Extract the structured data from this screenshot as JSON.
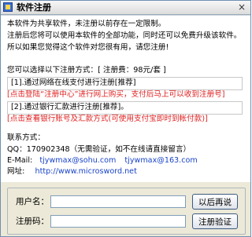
{
  "window": {
    "title": "软件注册",
    "close_glyph": "×"
  },
  "intro": {
    "line1": "本软件为共享软件，未注册以前存在一定限制。",
    "line2": "注册后您将可以使用本软件的全部功能，同时还可以免费升级该软件。",
    "line3": "所以如果您觉得这个软件对您很有用，请您注册!"
  },
  "pricing": {
    "text": "您可以选择以下注册方式：[ 注册费：98元/套 ]"
  },
  "method1": {
    "label": "[1].通过网络在线支付进行注册[推荐]",
    "note": "[点击登陆“注册中心”进行网上购买，支付后马上可以收到注册号]"
  },
  "method2": {
    "label": "[2].通过银行汇款进行注册[推荐]。",
    "note": "[点击查看银行账号及汇款方式(可使用支付宝即时到帐付款)]"
  },
  "contact": {
    "heading": "联系方式：",
    "qq": "QQ：170902348（无需验证，如不在线请直接留言）",
    "email_label": "E-Mail:",
    "email1": "tjywmax@sohu.com",
    "email2": "tjywmax@163.com",
    "site_label": "网址:",
    "site": "http://www.microsword.net"
  },
  "form": {
    "username_label": "用户名：",
    "username_value": "",
    "code_label": "注册码：",
    "code_value": "",
    "later_button": "以后再说",
    "verify_button": "注册验证"
  },
  "colors": {
    "accent_red": "#e01f1f",
    "link_blue": "#1a44c8"
  }
}
